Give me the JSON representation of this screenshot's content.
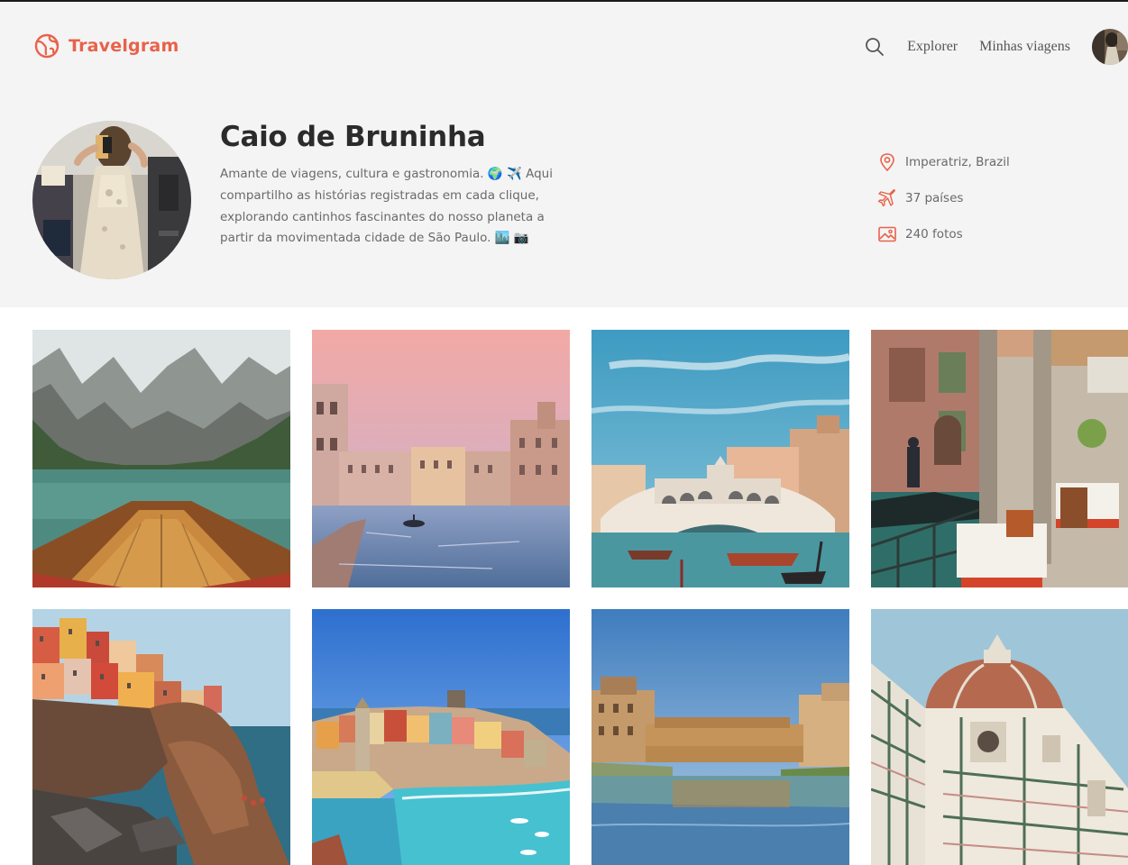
{
  "header": {
    "logo_text": "Travelgram",
    "brand_color": "#e8624a",
    "nav": {
      "search_icon": "search-icon",
      "explore_label": "Explorer",
      "trips_label": "Minhas viagens",
      "user_avatar": "avatar"
    }
  },
  "profile": {
    "name": "Caio de Bruninha",
    "bio": "Amante de viagens, cultura e gastronomia. 🌍 ✈️ Aqui compartilho as histórias registradas em cada clique, explorando cantinhos fascinantes do nosso planeta a partir da movimentada cidade de São Paulo. 🏙️ 📷",
    "stats": [
      {
        "icon": "location-pin-icon",
        "text": "Imperatriz, Brazil"
      },
      {
        "icon": "airplane-icon",
        "text": "37 países"
      },
      {
        "icon": "image-icon",
        "text": "240 fotos"
      }
    ]
  },
  "gallery": {
    "photos": [
      {
        "name": "photo-mountain-lake-boat",
        "subject": "Boat on a mountain lake"
      },
      {
        "name": "photo-venice-canal-sunset",
        "subject": "Venice canal at sunset"
      },
      {
        "name": "photo-rialto-bridge",
        "subject": "Rialto Bridge, Venice"
      },
      {
        "name": "photo-venice-canal-cafe",
        "subject": "Canal-side café with gondola"
      },
      {
        "name": "photo-manarola",
        "subject": "Manarola cliffside village"
      },
      {
        "name": "photo-vernazza",
        "subject": "Vernazza harbor"
      },
      {
        "name": "photo-ponte-vecchio",
        "subject": "Ponte Vecchio, Florence"
      },
      {
        "name": "photo-florence-duomo",
        "subject": "Florence Cathedral dome"
      }
    ]
  }
}
